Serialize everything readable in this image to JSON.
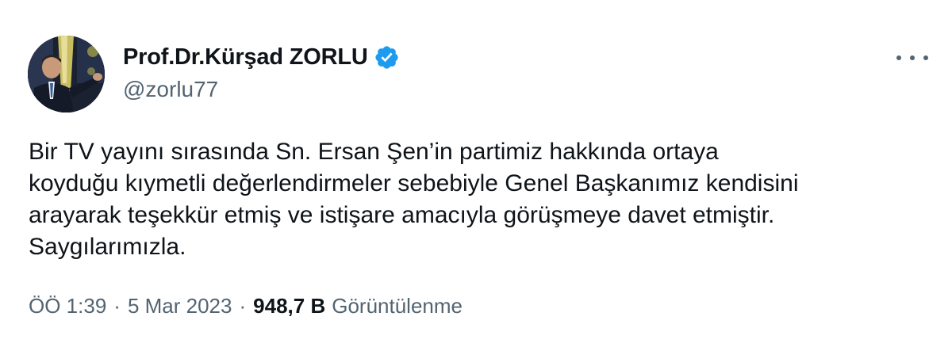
{
  "author": {
    "display_name": "Prof.Dr.Kürşad ZORLU",
    "handle": "@zorlu77",
    "verified": true
  },
  "tweet": {
    "lines": [
      "Bir TV yayını sırasında Sn. Ersan Şen’in partimiz hakkında ortaya",
      "koyduğu kıymetli değerlendirmeler sebebiyle Genel Başkanımız kendisini",
      "arayarak teşekkür etmiş ve istişare amacıyla görüşmeye davet etmiştir.",
      "Saygılarımızla."
    ]
  },
  "meta": {
    "time": "ÖÖ 1:39",
    "separator": "·",
    "date": "5 Mar 2023",
    "views_count": "948,7 B",
    "views_label": "Görüntülenme"
  },
  "icons": {
    "verified": "verified-badge-icon",
    "more": "more-options-icon"
  },
  "colors": {
    "text_primary": "#0f1419",
    "text_secondary": "#536471",
    "verified_blue": "#1d9bf0",
    "background": "#ffffff"
  }
}
